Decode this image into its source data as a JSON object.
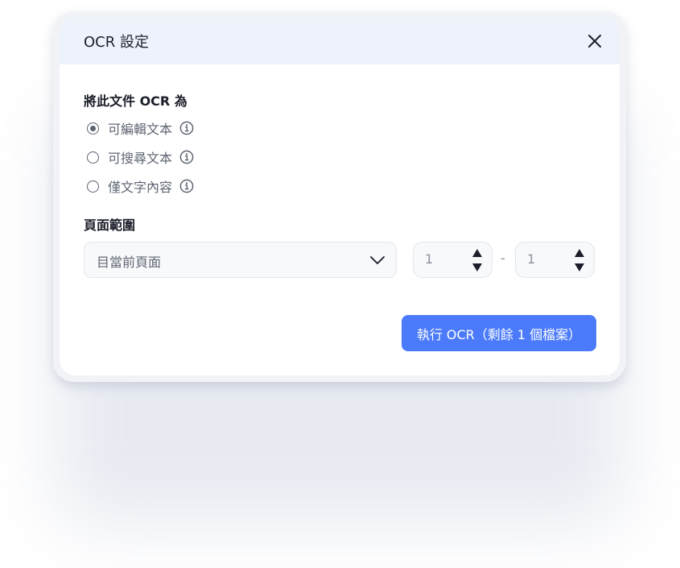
{
  "dialog": {
    "title": "OCR 設定",
    "close_icon": "close-icon"
  },
  "ocr_mode": {
    "label": "將此文件 OCR 為",
    "options": [
      {
        "label": "可編輯文本",
        "selected": true,
        "icon": "info-icon"
      },
      {
        "label": "可搜尋文本",
        "selected": false,
        "icon": "info-icon"
      },
      {
        "label": "僅文字內容",
        "selected": false,
        "icon": "info-icon"
      }
    ]
  },
  "page_range": {
    "label": "頁面範圍",
    "selected": "目當前頁面",
    "chevron_icon": "chevron-down-icon",
    "from": "1",
    "to": "1",
    "separator": "-"
  },
  "action": {
    "run_label": "執行 OCR（剩餘 1 個檔案）"
  },
  "colors": {
    "accent": "#4b7bfa",
    "header_bg": "#eef2fb"
  }
}
